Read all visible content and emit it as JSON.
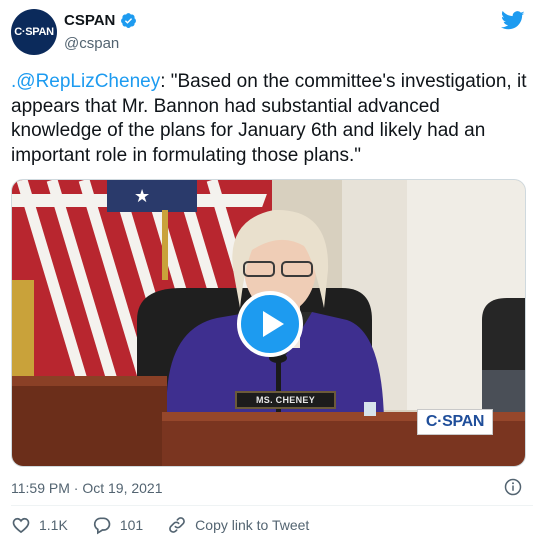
{
  "header": {
    "avatar_text": "C·SPAN",
    "display_name": "CSPAN",
    "handle": "@cspan",
    "verified_icon": "verified-badge-icon",
    "brand_icon": "twitter-bird-icon"
  },
  "tweet": {
    "mention": ".@RepLizCheney",
    "body": ": \"Based on the committee's investigation, it appears that Mr. Bannon had substantial advanced knowledge of the plans for January 6th and likely had an important role in formulating those plans.\""
  },
  "media": {
    "nameplate": "MS. CHENEY",
    "network_bug": "C·SPAN",
    "play_icon": "play-icon"
  },
  "meta": {
    "timestamp": "11:59 PM · Oct 19, 2021",
    "info_icon": "info-icon"
  },
  "actions": {
    "like_count": "1.1K",
    "reply_count": "101",
    "copy_link_label": "Copy link to Tweet"
  },
  "colors": {
    "accent": "#1d9bf0",
    "text": "#0f1419",
    "muted": "#536471",
    "avatar_bg": "#0b2a5b"
  }
}
